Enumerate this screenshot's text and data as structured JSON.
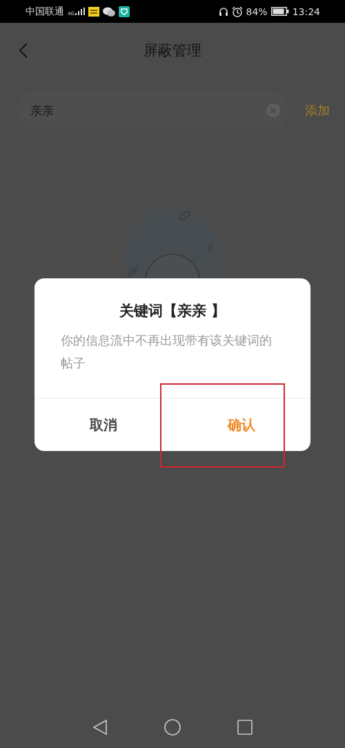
{
  "status_bar": {
    "carrier": "中国联通",
    "network": "4G",
    "battery": "84%",
    "time": "13:24"
  },
  "header": {
    "title": "屏蔽管理"
  },
  "keyword_field": {
    "value": "亲亲",
    "add_label": "添加"
  },
  "dialog": {
    "title": "关键词【亲亲 】",
    "message": "你的信息流中不再出现带有该关键词的帖子",
    "buttons": [
      {
        "label": "取消",
        "kind": "cancel"
      },
      {
        "label": "确认",
        "kind": "confirm"
      }
    ]
  },
  "annotations": [
    {
      "kind": "frame",
      "color": "#d0262b"
    }
  ]
}
